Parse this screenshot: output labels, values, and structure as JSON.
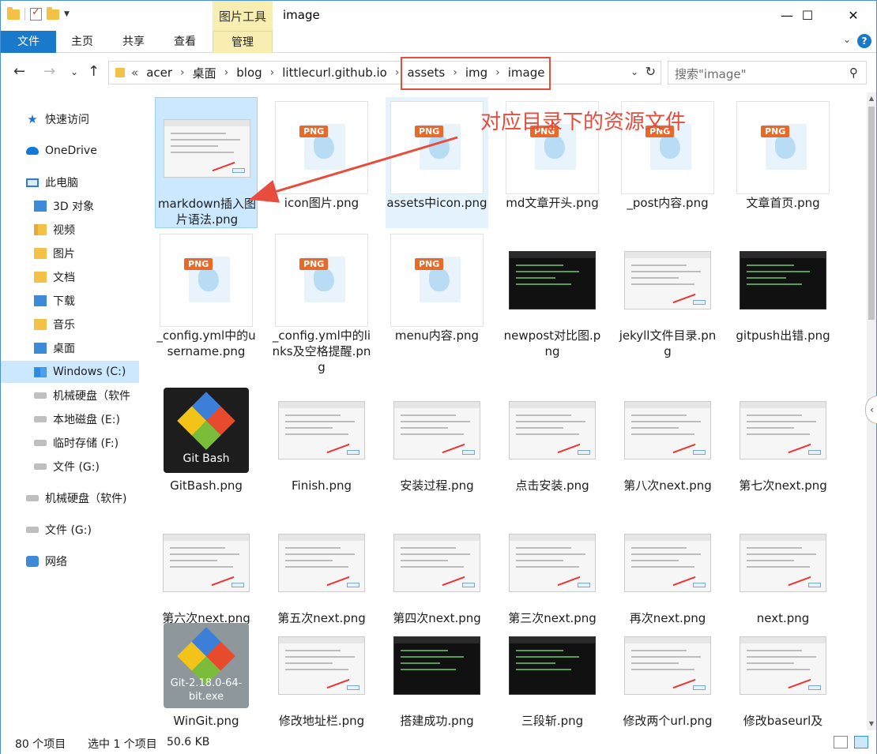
{
  "window": {
    "title": "image",
    "context_tab": "图片工具",
    "controls": {
      "minimize": "—",
      "maximize": "☐",
      "close": "✕"
    }
  },
  "ribbon": {
    "tabs": [
      "文件",
      "主页",
      "共享",
      "查看",
      "管理"
    ],
    "help": "?"
  },
  "address": {
    "lead": "«",
    "path": [
      "acer",
      "桌面",
      "blog",
      "littlecurl.github.io",
      "assets",
      "img",
      "image"
    ]
  },
  "search": {
    "placeholder": "搜索\"image\""
  },
  "nav": [
    {
      "label": "快速访问",
      "icon": "star-icon"
    },
    {
      "label": "OneDrive",
      "icon": "cloud-icon"
    },
    {
      "label": "此电脑",
      "icon": "computer-icon"
    },
    {
      "label": "3D 对象",
      "icon": "folder-3d-icon"
    },
    {
      "label": "视频",
      "icon": "video-folder-icon"
    },
    {
      "label": "图片",
      "icon": "pictures-folder-icon"
    },
    {
      "label": "文档",
      "icon": "documents-folder-icon"
    },
    {
      "label": "下载",
      "icon": "downloads-folder-icon"
    },
    {
      "label": "音乐",
      "icon": "music-folder-icon"
    },
    {
      "label": "桌面",
      "icon": "desktop-folder-icon"
    },
    {
      "label": "Windows (C:)",
      "icon": "windows-drive-icon",
      "selected": true
    },
    {
      "label": "机械硬盘（软件",
      "icon": "drive-icon"
    },
    {
      "label": "本地磁盘 (E:)",
      "icon": "drive-icon"
    },
    {
      "label": "临时存储 (F:)",
      "icon": "drive-icon"
    },
    {
      "label": "文件 (G:)",
      "icon": "drive-icon"
    },
    {
      "label": "机械硬盘（软件)",
      "icon": "drive-icon"
    },
    {
      "label": "文件 (G:)",
      "icon": "drive-icon"
    },
    {
      "label": "网络",
      "icon": "network-icon"
    }
  ],
  "files": [
    {
      "name": "markdown插入图片语法.png",
      "thumb": "screenshot-light",
      "selected": true
    },
    {
      "name": "icon图片.png",
      "thumb": "png-generic"
    },
    {
      "name": "assets中icon.png",
      "thumb": "png-generic",
      "hover": true
    },
    {
      "name": "md文章开头.png",
      "thumb": "png-generic"
    },
    {
      "name": "_post内容.png",
      "thumb": "png-generic"
    },
    {
      "name": "文章首页.png",
      "thumb": "png-generic"
    },
    {
      "name": "_config.yml中的username.png",
      "thumb": "png-generic"
    },
    {
      "name": "_config.yml中的links及空格提醒.png",
      "thumb": "png-generic"
    },
    {
      "name": "menu内容.png",
      "thumb": "png-generic"
    },
    {
      "name": "newpost对比图.png",
      "thumb": "screenshot-dark"
    },
    {
      "name": "jekyll文件目录.png",
      "thumb": "screenshot-light"
    },
    {
      "name": "gitpush出错.png",
      "thumb": "screenshot-dark"
    },
    {
      "name": "GitBash.png",
      "thumb": "git-dark",
      "caption": "Git Bash"
    },
    {
      "name": "Finish.png",
      "thumb": "screenshot-light"
    },
    {
      "name": "安装过程.png",
      "thumb": "screenshot-light"
    },
    {
      "name": "点击安装.png",
      "thumb": "screenshot-light"
    },
    {
      "name": "第八次next.png",
      "thumb": "screenshot-light"
    },
    {
      "name": "第七次next.png",
      "thumb": "screenshot-light"
    },
    {
      "name": "第六次next.png",
      "thumb": "screenshot-light"
    },
    {
      "name": "第五次next.png",
      "thumb": "screenshot-light"
    },
    {
      "name": "第四次next.png",
      "thumb": "screenshot-light"
    },
    {
      "name": "第三次next.png",
      "thumb": "screenshot-light"
    },
    {
      "name": "再次next.png",
      "thumb": "screenshot-light"
    },
    {
      "name": "next.png",
      "thumb": "screenshot-light"
    },
    {
      "name": "WinGit.png",
      "thumb": "git-light",
      "caption": "Git-2.18.0-64-bit.exe"
    },
    {
      "name": "修改地址栏.png",
      "thumb": "screenshot-light"
    },
    {
      "name": "搭建成功.png",
      "thumb": "screenshot-dark"
    },
    {
      "name": "三段斩.png",
      "thumb": "screenshot-dark"
    },
    {
      "name": "修改两个url.png",
      "thumb": "screenshot-light"
    },
    {
      "name": "修改baseurl及",
      "thumb": "screenshot-light"
    }
  ],
  "annotation": "对应目录下的资源文件",
  "status": {
    "count": "80 个项目",
    "selection": "选中 1 个项目",
    "size": "50.6 KB"
  },
  "colors": {
    "accent": "#1979ca",
    "selection": "#cce8ff",
    "annotation": "#e74c3c",
    "context_tab": "#f9eeb2"
  }
}
